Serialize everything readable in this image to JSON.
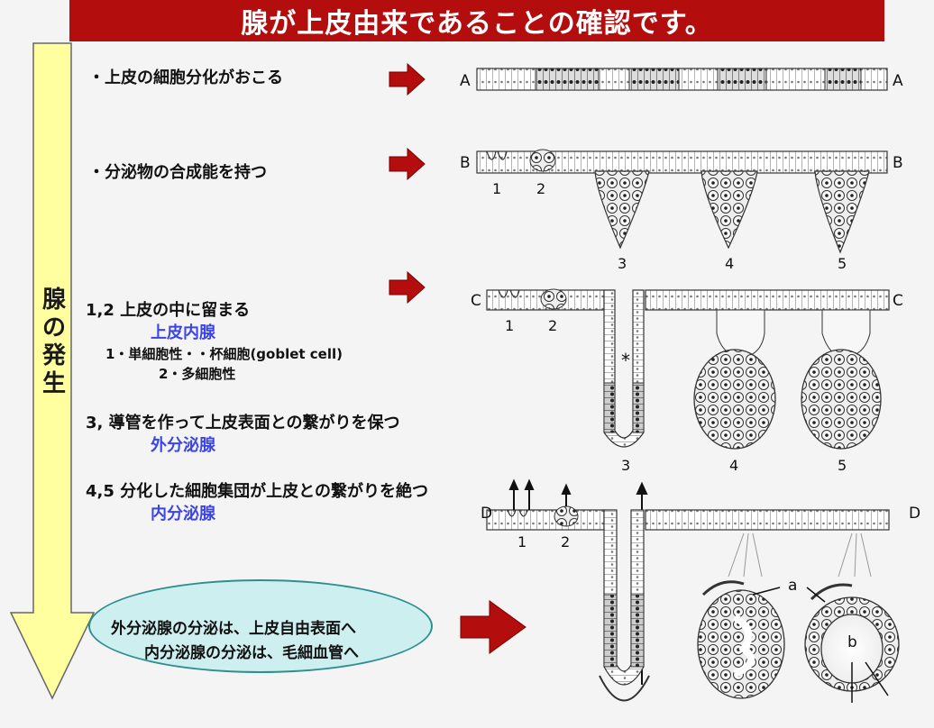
{
  "title": "腺が上皮由来であることの確認です。",
  "side_arrow": {
    "label": "腺の発生",
    "color": "#ffffa0"
  },
  "rows": {
    "a": {
      "text": "・上皮の細胞分化がおこる",
      "diagram_label": "A"
    },
    "b": {
      "text": "・分泌物の合成能を持つ",
      "diagram_label": "B"
    },
    "c": {
      "diagram_label": "C"
    },
    "d": {
      "diagram_label": "D"
    }
  },
  "points": {
    "p12": {
      "heading": "1,2 上皮の中に留まる",
      "term": "上皮内腺",
      "sub1": "1・単細胞性・・杯細胞(goblet cell)",
      "sub2": "2・多細胞性"
    },
    "p3": {
      "heading": "3, 導管を作って上皮表面との繋がりを保つ",
      "term": "外分泌腺"
    },
    "p45": {
      "heading": "4,5 分化した細胞集団が上皮との繋がりを絶つ",
      "term": "内分泌腺"
    }
  },
  "summary": {
    "line1": "外分泌腺の分泌は、上皮自由表面へ",
    "line2": "内分泌腺の分泌は、毛細血管へ"
  },
  "diagram_numbers": {
    "n1": "1",
    "n2": "2",
    "n3": "3",
    "n4": "4",
    "n5": "5",
    "a": "a",
    "b": "b",
    "star": "*"
  },
  "colors": {
    "title_bg": "#b40d0d",
    "arrow_red": "#b40d0d",
    "term_blue": "#3b44e6",
    "oval_bg": "#cdeff0"
  }
}
